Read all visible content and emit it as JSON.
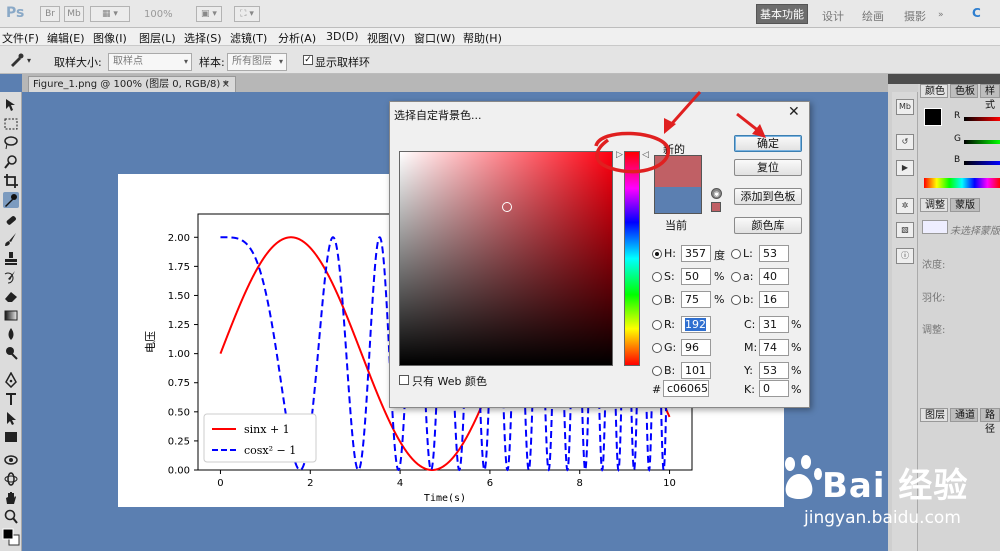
{
  "app": {
    "logo": "Ps"
  },
  "topbar": {
    "zoom": "100%",
    "workspaces": [
      "基本功能",
      "设计",
      "绘画",
      "摄影"
    ],
    "active_workspace": "基本功能",
    "cs_live": "C"
  },
  "menu": [
    "文件(F)",
    "编辑(E)",
    "图像(I)",
    "图层(L)",
    "选择(S)",
    "滤镜(T)",
    "分析(A)",
    "3D(D)",
    "视图(V)",
    "窗口(W)",
    "帮助(H)"
  ],
  "options": {
    "sample_size_label": "取样大小:",
    "sample_size_value": "取样点",
    "sample_label": "样本:",
    "sample_value": "所有图层",
    "show_ring_label": "显示取样环",
    "show_ring_checked": true
  },
  "document": {
    "tab_title": "Figure_1.png @ 100% (图层 0, RGB/8) *",
    "close": "×"
  },
  "dialog": {
    "title": "选择自定背景色...",
    "close": "✕",
    "new_label": "新的",
    "current_label": "当前",
    "new_color": "#c06065",
    "current_color": "#5b7fb1",
    "buttons": {
      "ok": "确定",
      "reset": "复位",
      "add_swatch": "添加到色板",
      "color_libraries": "颜色库"
    },
    "hsb": [
      {
        "key": "H:",
        "value": "357",
        "unit": "度",
        "selected": true
      },
      {
        "key": "S:",
        "value": "50",
        "unit": "%",
        "selected": false
      },
      {
        "key": "B:",
        "value": "75",
        "unit": "%",
        "selected": false
      }
    ],
    "rgb": [
      {
        "key": "R:",
        "value": "192",
        "selected": false
      },
      {
        "key": "G:",
        "value": "96",
        "selected": false
      },
      {
        "key": "B:",
        "value": "101",
        "selected": false
      }
    ],
    "lab": [
      {
        "key": "L:",
        "value": "53"
      },
      {
        "key": "a:",
        "value": "40"
      },
      {
        "key": "b:",
        "value": "16"
      }
    ],
    "cmyk": [
      {
        "key": "C:",
        "value": "31",
        "unit": "%"
      },
      {
        "key": "M:",
        "value": "74",
        "unit": "%"
      },
      {
        "key": "Y:",
        "value": "53",
        "unit": "%"
      },
      {
        "key": "K:",
        "value": "0",
        "unit": "%"
      }
    ],
    "web_only_label": "只有 Web 颜色",
    "web_only_checked": false,
    "hex_label": "#",
    "hex_value": "c06065"
  },
  "panels": {
    "color_tabs": [
      "颜色",
      "色板",
      "样式"
    ],
    "color_channels": [
      "R",
      "G",
      "B"
    ],
    "adjust_tabs": [
      "调整",
      "蒙版"
    ],
    "mask_hint": "未选择蒙版",
    "mask_fields": [
      "浓度:",
      "羽化:",
      "调整:"
    ],
    "layer_tabs": [
      "图层",
      "通道",
      "路径"
    ]
  },
  "chart_data": {
    "type": "line",
    "xlabel": "Time(s)",
    "ylabel": "电压",
    "xlim": [
      -0.5,
      10.5
    ],
    "ylim": [
      0,
      2.2
    ],
    "xticks": [
      "0",
      "2",
      "4",
      "6",
      "8",
      "10"
    ],
    "yticks": [
      "0.00",
      "0.25",
      "0.50",
      "0.75",
      "1.00",
      "1.25",
      "1.50",
      "1.75",
      "2.00"
    ],
    "legend_position": "lower-left",
    "series": [
      {
        "name": "sinx + 1",
        "formula": "sin(x)+1",
        "color": "#ff0000",
        "style": "solid"
      },
      {
        "name": "cosx² − 1",
        "formula": "cos(x^2)+1",
        "color": "#0000ff",
        "style": "dashed"
      }
    ],
    "x_range": [
      0,
      10
    ]
  },
  "watermark": {
    "brand": "Bai 经验",
    "site": "jingyan.baidu.com"
  }
}
